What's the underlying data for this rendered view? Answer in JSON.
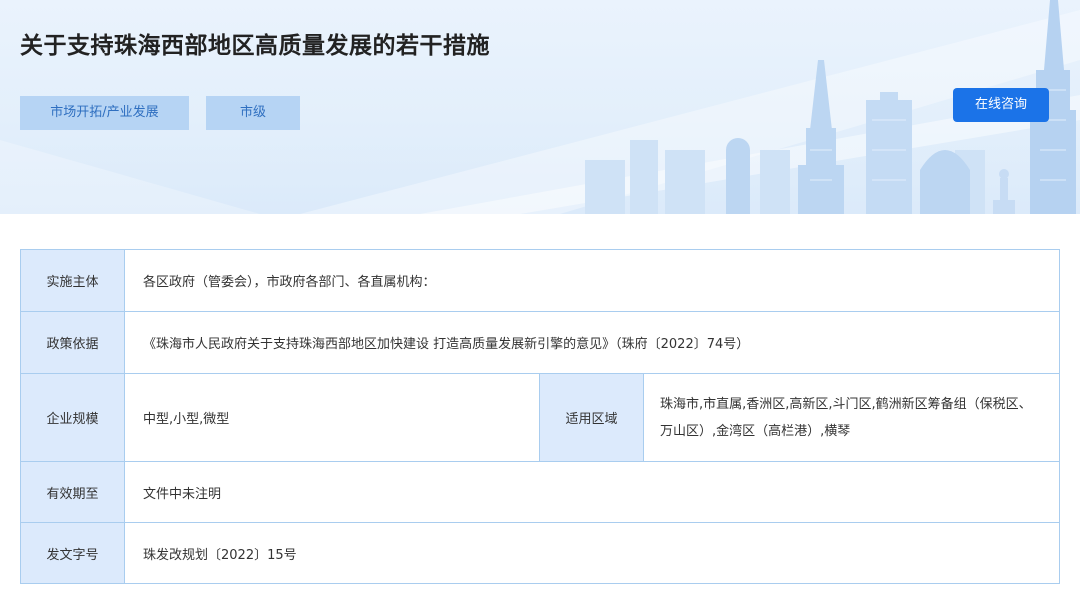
{
  "page_title": "关于支持珠海西部地区高质量发展的若干措施",
  "tags": [
    "市场开拓/产业发展",
    "市级"
  ],
  "consult_button": "在线咨询",
  "rows": {
    "implementing_body": {
      "label": "实施主体",
      "value": "各区政府（管委会），市政府各部门、各直属机构："
    },
    "policy_basis": {
      "label": "政策依据",
      "value": "《珠海市人民政府关于支持珠海西部地区加快建设 打造高质量发展新引擎的意见》（珠府〔2022〕74号）"
    },
    "enterprise_scale": {
      "label": "企业规模",
      "value": "中型,小型,微型"
    },
    "applicable_area": {
      "label": "适用区域",
      "value": "珠海市,市直属,香洲区,高新区,斗门区,鹤洲新区筹备组（保税区、万山区）,金湾区（高栏港）,横琴"
    },
    "valid_until": {
      "label": "有效期至",
      "value": "文件中未注明"
    },
    "document_number": {
      "label": "发文字号",
      "value": "珠发改规划〔2022〕15号"
    }
  },
  "colors": {
    "accent": "#1b73e8",
    "tag_bg": "#b6d4f4",
    "tag_text": "#2f6fc0",
    "label_bg": "#dceafc",
    "border": "#a9cdef"
  }
}
